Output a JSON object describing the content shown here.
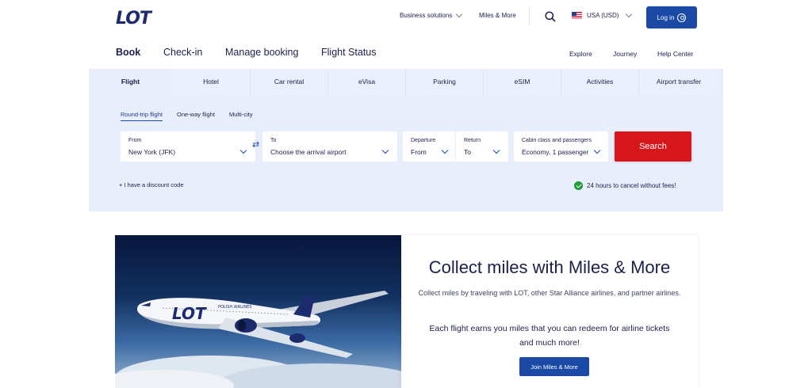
{
  "header": {
    "logo_text": "LOT",
    "business_solutions": "Business solutions",
    "miles_more": "Miles & More",
    "currency": "USA (USD)",
    "login": "Log in"
  },
  "main_nav": {
    "book": "Book",
    "checkin": "Check-in",
    "manage": "Manage booking",
    "status": "Flight Status"
  },
  "secondary_nav": {
    "explore": "Explore",
    "journey": "Journey",
    "help": "Help Center"
  },
  "tabs": [
    {
      "label": "Flight"
    },
    {
      "label": "Hotel"
    },
    {
      "label": "Car rental"
    },
    {
      "label": "eVisa"
    },
    {
      "label": "Parking"
    },
    {
      "label": "eSIM"
    },
    {
      "label": "Activities"
    },
    {
      "label": "Airport transfer"
    }
  ],
  "trip_types": {
    "round": "Round-trip flight",
    "oneway": "One-way flight",
    "multi": "Multi-city"
  },
  "form": {
    "from_label": "From",
    "from_value": "New York (JFK)",
    "to_label": "To",
    "to_value": "Choose the arrival airport",
    "departure_label": "Departure",
    "departure_value": "From",
    "return_label": "Return",
    "return_value": "To",
    "cabin_label": "Cabin class and passengers",
    "cabin_value": "Economy, 1 passenger",
    "search": "Search",
    "discount": "+ I have a discount code",
    "cancel_note": "24 hours to cancel without fees!"
  },
  "promo": {
    "title": "Collect miles with Miles & More",
    "text1": "Collect miles by traveling with LOT, other Star Alliance airlines, and partner airlines.",
    "text2": "Each flight earns you miles that you can redeem for airline tickets and much more!",
    "button": "Join Miles & More",
    "plane_logo": "LOT",
    "plane_text": "POLISH AIRLINES"
  },
  "colors": {
    "brand_blue": "#1a4aa6",
    "search_red": "#d7161c",
    "panel_bg": "#e8eefb"
  }
}
